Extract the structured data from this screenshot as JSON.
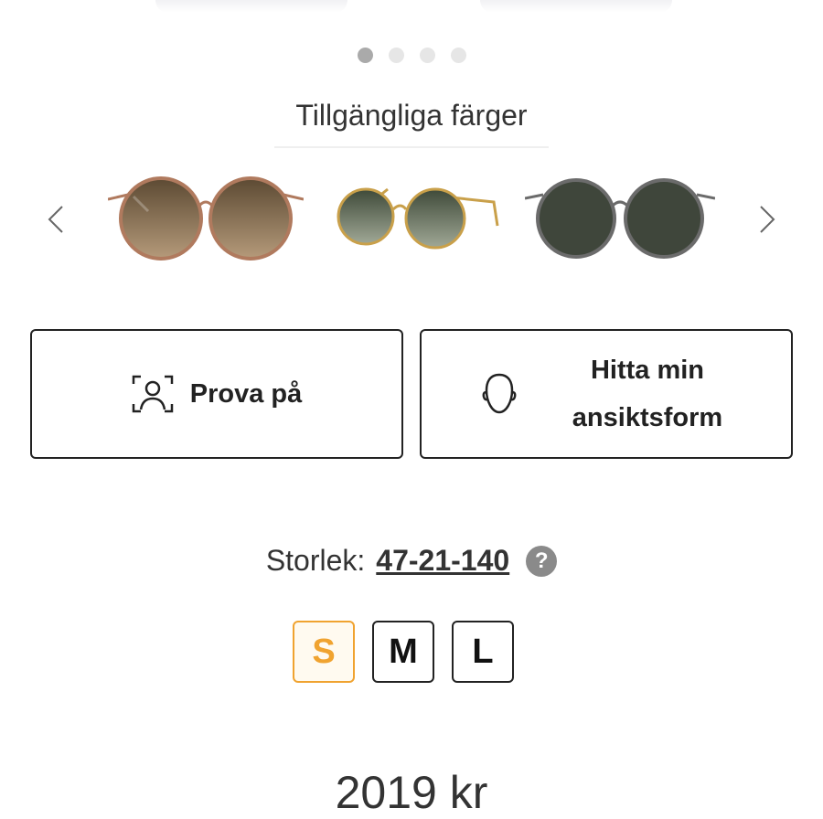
{
  "carousel": {
    "page_count": 4,
    "active_index": 0
  },
  "colors": {
    "title": "Tillgängliga färger",
    "prev_icon": "chevron-left-icon",
    "next_icon": "chevron-right-icon",
    "swatches": [
      {
        "name": "brown-gradient-bronze-frame",
        "lens": "#6b5a40",
        "frame": "#b07a5e"
      },
      {
        "name": "green-gradient-gold-frame",
        "lens": "#4f5a48",
        "frame": "#c9a04a"
      },
      {
        "name": "green-gunmetal-frame",
        "lens": "#3f463b",
        "frame": "#6b6b6b"
      }
    ]
  },
  "actions": {
    "try_on_label": "Prova på",
    "try_on_icon": "face-scan-icon",
    "face_shape_label_line1": "Hitta min",
    "face_shape_label_line2": "ansiktsform",
    "face_shape_icon": "head-outline-icon"
  },
  "size": {
    "label": "Storlek:",
    "value": "47-21-140",
    "help_symbol": "?",
    "options": [
      "S",
      "M",
      "L"
    ],
    "selected": "S",
    "accent": "#f0a330"
  },
  "price": "2019 kr"
}
